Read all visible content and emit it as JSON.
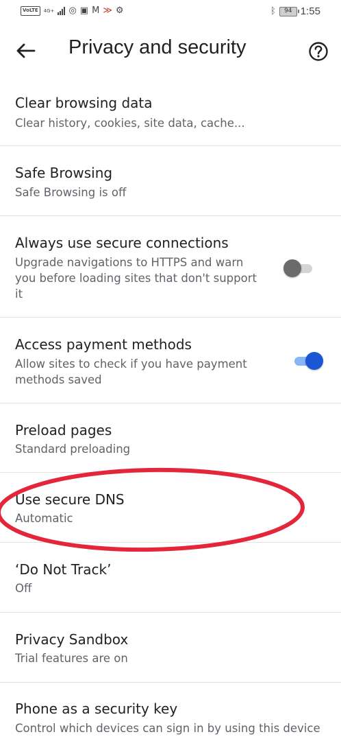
{
  "status_bar": {
    "volte_label": "VoLTE",
    "network_label": "4G+",
    "battery_level": "94",
    "time": "1:55"
  },
  "header": {
    "title": "Privacy and security",
    "back_icon": "arrow-back-icon",
    "help_icon": "help-circle-icon"
  },
  "items": [
    {
      "title": "Clear browsing data",
      "subtitle": "Clear history, cookies, site data, cache..."
    },
    {
      "title": "Safe Browsing",
      "subtitle": "Safe Browsing is off"
    },
    {
      "title": "Always use secure connections",
      "subtitle_lines": [
        "Upgrade navigations to HTTPS and warn",
        "you before loading sites that don't support",
        "it"
      ],
      "toggle": false
    },
    {
      "title": "Access payment methods",
      "subtitle_lines": [
        "Allow sites to check if you have payment",
        "methods saved"
      ],
      "toggle": true
    },
    {
      "title": "Preload pages",
      "subtitle": "Standard preloading"
    },
    {
      "title": "Use secure DNS",
      "subtitle": "Automatic"
    },
    {
      "title": "‘Do Not Track’",
      "subtitle": "Off"
    },
    {
      "title": "Privacy Sandbox",
      "subtitle": "Trial features are on"
    },
    {
      "title": "Phone as a security key",
      "subtitle": "Control which devices can sign in by using this device"
    }
  ],
  "colors": {
    "accent": "#1a57d5",
    "annotation": "#e3263a",
    "divider": "#e2e2e2"
  }
}
